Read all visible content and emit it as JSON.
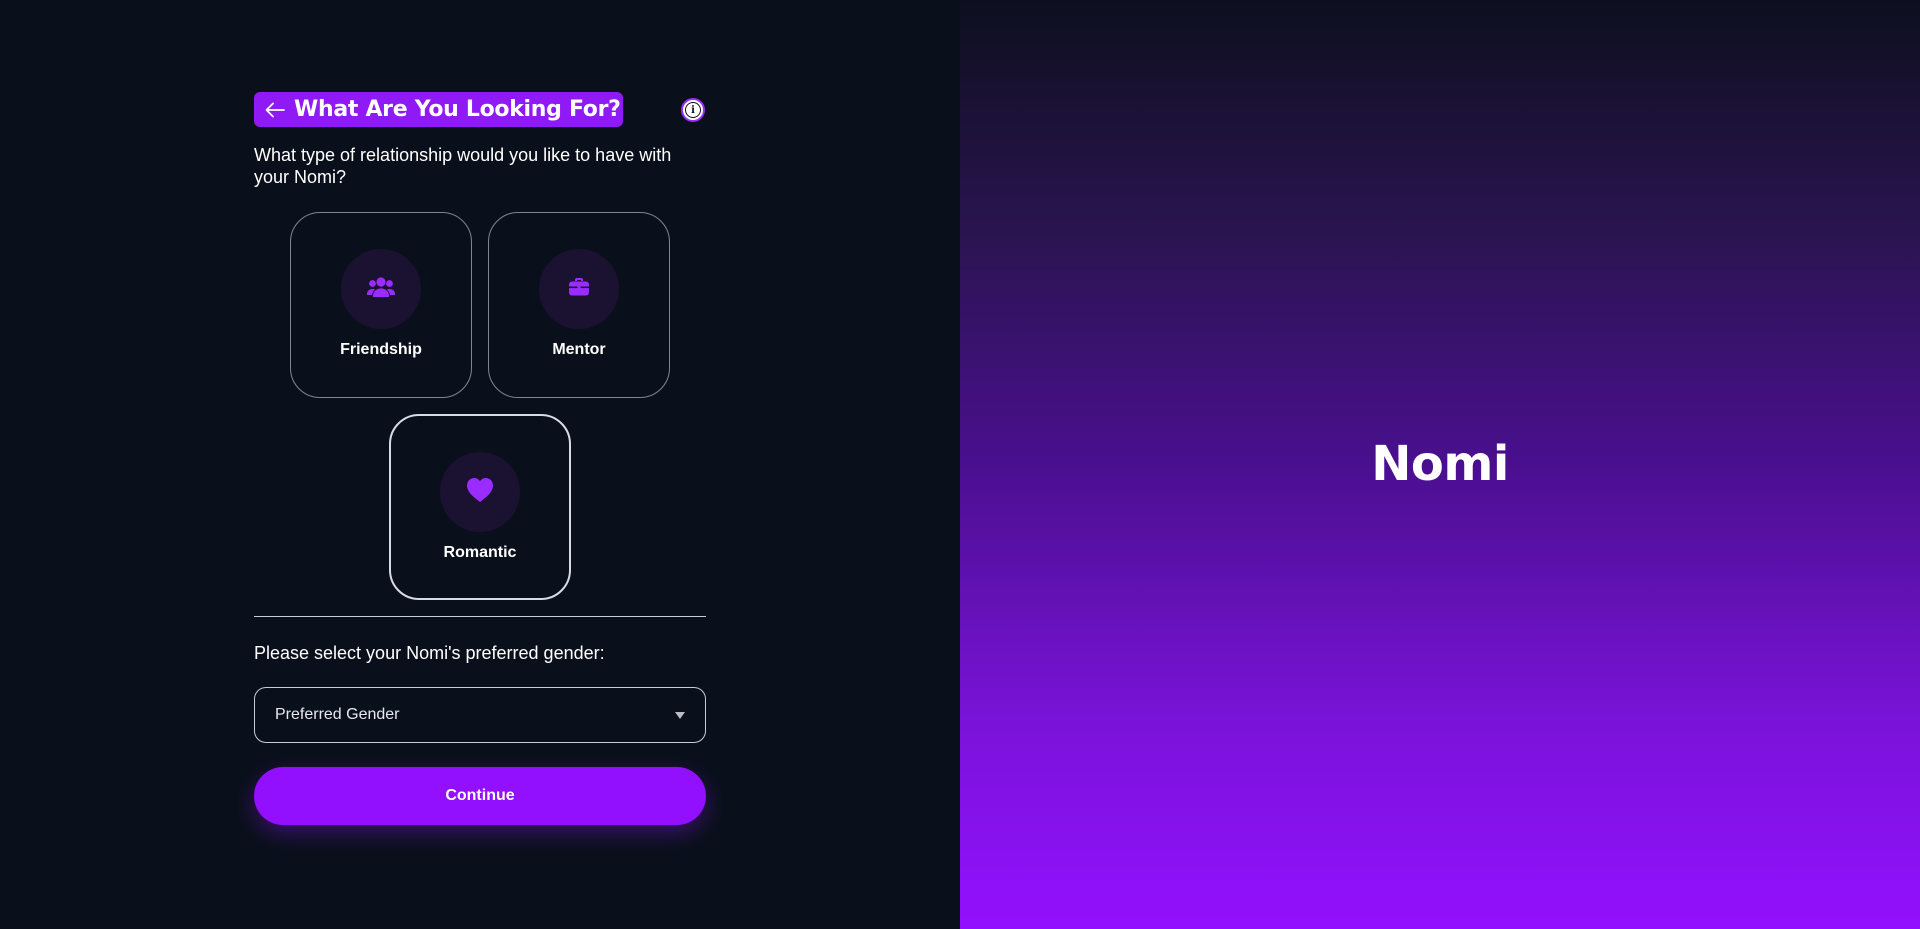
{
  "header": {
    "title": "What Are You Looking For?",
    "back_icon": "arrow-left-icon",
    "info_icon": "info-icon",
    "info_glyph": "i"
  },
  "question": "What type of relationship would you like to have with your Nomi?",
  "relationship_options": [
    {
      "label": "Friendship",
      "icon": "users-icon",
      "selected": false
    },
    {
      "label": "Mentor",
      "icon": "briefcase-icon",
      "selected": false
    },
    {
      "label": "Romantic",
      "icon": "heart-icon",
      "selected": true
    }
  ],
  "gender": {
    "label": "Please select your Nomi's preferred gender:",
    "select_value": "Preferred Gender",
    "caret_icon": "caret-down-icon"
  },
  "continue_label": "Continue",
  "brand": {
    "name": "Nomi"
  },
  "colors": {
    "accent": "#9310ff",
    "background": "#0a101b",
    "icon_circle": "#1a1230",
    "card_border": "#7e8593"
  }
}
